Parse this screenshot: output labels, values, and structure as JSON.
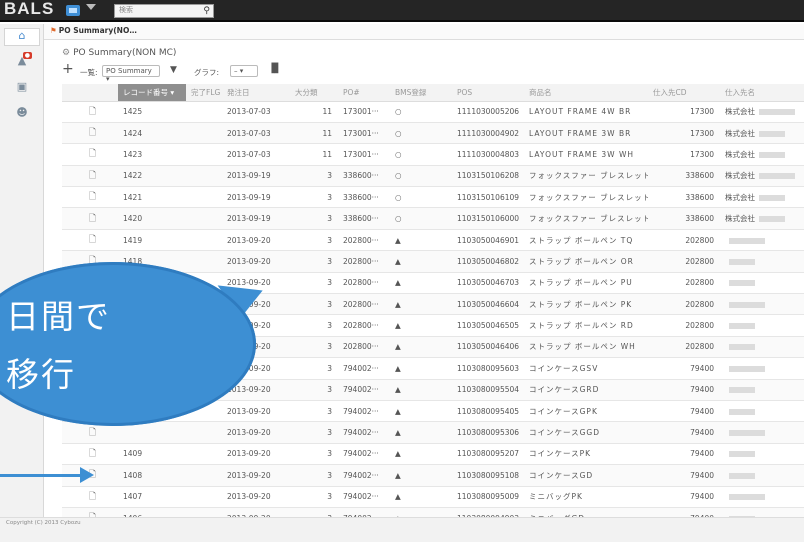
{
  "app": {
    "logo": "BALS",
    "search_placeholder": "検索"
  },
  "tab": {
    "label": "PO Summary(NO…"
  },
  "page": {
    "title": "PO Summary(NON MC)",
    "list_label": "一覧:",
    "list_value": "PO Summary ▾",
    "graph_label": "グラフ:",
    "graph_value": "– ▾"
  },
  "table": {
    "headers": [
      "",
      "レコード番号 ▾",
      "完了FLG",
      "発注日",
      "大分類",
      "PO#",
      "BMS登録",
      "POS",
      "商品名",
      "仕入先CD",
      "仕入先名"
    ],
    "rows": [
      {
        "rec": "1425",
        "date": "2013-07-03",
        "cat": "11",
        "po": "173001···",
        "bms": "○",
        "pos": "1111030005206",
        "name": "LAYOUT FRAME 4W BR",
        "sup": "17300",
        "supn": "株式会社"
      },
      {
        "rec": "1424",
        "date": "2013-07-03",
        "cat": "11",
        "po": "173001···",
        "bms": "○",
        "pos": "1111030004902",
        "name": "LAYOUT FRAME 3W BR",
        "sup": "17300",
        "supn": "株式会社"
      },
      {
        "rec": "1423",
        "date": "2013-07-03",
        "cat": "11",
        "po": "173001···",
        "bms": "○",
        "pos": "1111030004803",
        "name": "LAYOUT FRAME 3W WH",
        "sup": "17300",
        "supn": "株式会社"
      },
      {
        "rec": "1422",
        "date": "2013-09-19",
        "cat": "3",
        "po": "338600···",
        "bms": "○",
        "pos": "1103150106208",
        "name": "フォックスファー ブレスレット BK",
        "sup": "338600",
        "supn": "株式会社"
      },
      {
        "rec": "1421",
        "date": "2013-09-19",
        "cat": "3",
        "po": "338600···",
        "bms": "○",
        "pos": "1103150106109",
        "name": "フォックスファー ブレスレット RD",
        "sup": "338600",
        "supn": "株式会社"
      },
      {
        "rec": "1420",
        "date": "2013-09-19",
        "cat": "3",
        "po": "338600···",
        "bms": "○",
        "pos": "1103150106000",
        "name": "フォックスファー ブレスレット WH",
        "sup": "338600",
        "supn": "株式会社"
      },
      {
        "rec": "1419",
        "date": "2013-09-20",
        "cat": "3",
        "po": "202800···",
        "bms": "▲",
        "pos": "1103050046901",
        "name": "ストラップ ボールペン TQ",
        "sup": "202800",
        "supn": ""
      },
      {
        "rec": "1418",
        "date": "2013-09-20",
        "cat": "3",
        "po": "202800···",
        "bms": "▲",
        "pos": "1103050046802",
        "name": "ストラップ ボールペン OR",
        "sup": "202800",
        "supn": ""
      },
      {
        "rec": "",
        "date": "2013-09-20",
        "cat": "3",
        "po": "202800···",
        "bms": "▲",
        "pos": "1103050046703",
        "name": "ストラップ ボールペン PU",
        "sup": "202800",
        "supn": ""
      },
      {
        "rec": "",
        "date": "2013-09-20",
        "cat": "3",
        "po": "202800···",
        "bms": "▲",
        "pos": "1103050046604",
        "name": "ストラップ ボールペン PK",
        "sup": "202800",
        "supn": ""
      },
      {
        "rec": "",
        "date": "2013-09-20",
        "cat": "3",
        "po": "202800···",
        "bms": "▲",
        "pos": "1103050046505",
        "name": "ストラップ ボールペン RD",
        "sup": "202800",
        "supn": ""
      },
      {
        "rec": "",
        "date": "2013-09-20",
        "cat": "3",
        "po": "202800···",
        "bms": "▲",
        "pos": "1103050046406",
        "name": "ストラップ ボールペン WH",
        "sup": "202800",
        "supn": ""
      },
      {
        "rec": "",
        "date": "2013-09-20",
        "cat": "3",
        "po": "794002···",
        "bms": "▲",
        "pos": "1103080095603",
        "name": "コインケースGSV",
        "sup": "79400",
        "supn": ""
      },
      {
        "rec": "",
        "date": "2013-09-20",
        "cat": "3",
        "po": "794002···",
        "bms": "▲",
        "pos": "1103080095504",
        "name": "コインケースGRD",
        "sup": "79400",
        "supn": ""
      },
      {
        "rec": "",
        "date": "2013-09-20",
        "cat": "3",
        "po": "794002···",
        "bms": "▲",
        "pos": "1103080095405",
        "name": "コインケースGPK",
        "sup": "79400",
        "supn": ""
      },
      {
        "rec": "",
        "date": "2013-09-20",
        "cat": "3",
        "po": "794002···",
        "bms": "▲",
        "pos": "1103080095306",
        "name": "コインケースGGD",
        "sup": "79400",
        "supn": ""
      },
      {
        "rec": "1409",
        "date": "2013-09-20",
        "cat": "3",
        "po": "794002···",
        "bms": "▲",
        "pos": "1103080095207",
        "name": "コインケースPK",
        "sup": "79400",
        "supn": ""
      },
      {
        "rec": "1408",
        "date": "2013-09-20",
        "cat": "3",
        "po": "794002···",
        "bms": "▲",
        "pos": "1103080095108",
        "name": "コインケースGD",
        "sup": "79400",
        "supn": ""
      },
      {
        "rec": "1407",
        "date": "2013-09-20",
        "cat": "3",
        "po": "794002···",
        "bms": "▲",
        "pos": "1103080095009",
        "name": "ミニバッグPK",
        "sup": "79400",
        "supn": ""
      },
      {
        "rec": "1406",
        "date": "2013-09-20",
        "cat": "3",
        "po": "794002···",
        "bms": "▲",
        "pos": "1103080094903",
        "name": "ミニバッグGD",
        "sup": "79400",
        "supn": ""
      }
    ]
  },
  "footer": {
    "copyright": "Copyright (C) 2013 Cybozu"
  },
  "callout": {
    "line1": "日間で",
    "line2": "移行"
  },
  "colors": {
    "callout": "#3d8fd3",
    "topbar": "#252525",
    "sorted_header": "#8f8f8f"
  }
}
